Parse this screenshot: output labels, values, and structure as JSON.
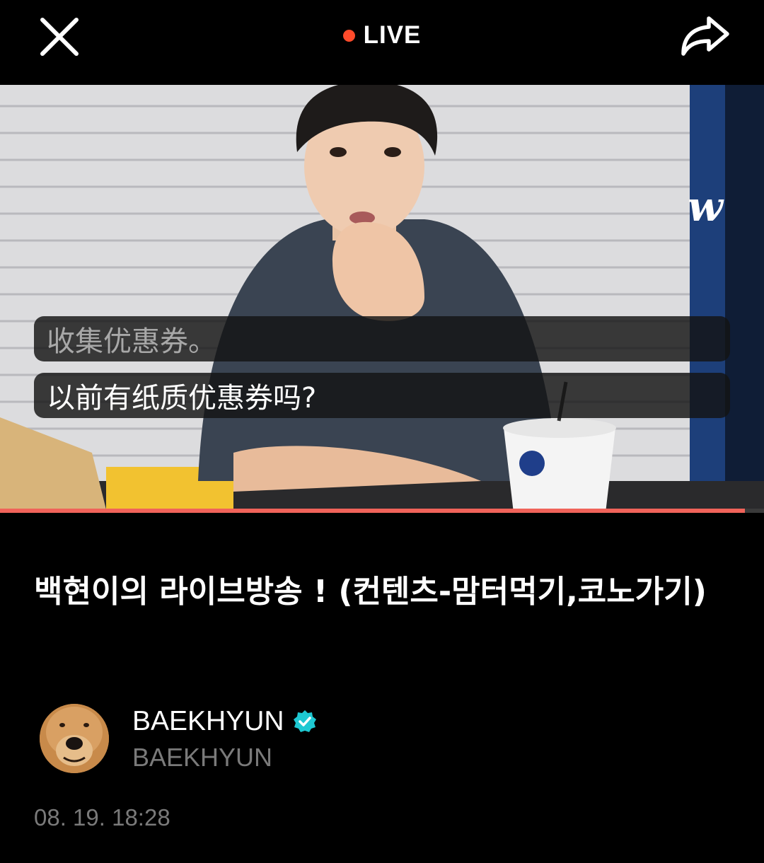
{
  "header": {
    "live_label": "LIVE",
    "live_color": "#ff4b2b",
    "close_icon": "close-icon",
    "share_icon": "share-icon"
  },
  "video": {
    "watermark": "w",
    "captions": [
      "收集优惠券。",
      "以前有纸质优惠券吗?"
    ],
    "progress_fraction": 0.975,
    "progress_color": "#f0635a"
  },
  "post": {
    "title": "백현이의 라이브방송 ! (컨텐츠-맘터먹기,코노가기)",
    "author_name": "BAEKHYUN",
    "author_handle": "BAEKHYUN",
    "verified_color": "#1ec8d2",
    "timestamp": "08. 19. 18:28"
  }
}
